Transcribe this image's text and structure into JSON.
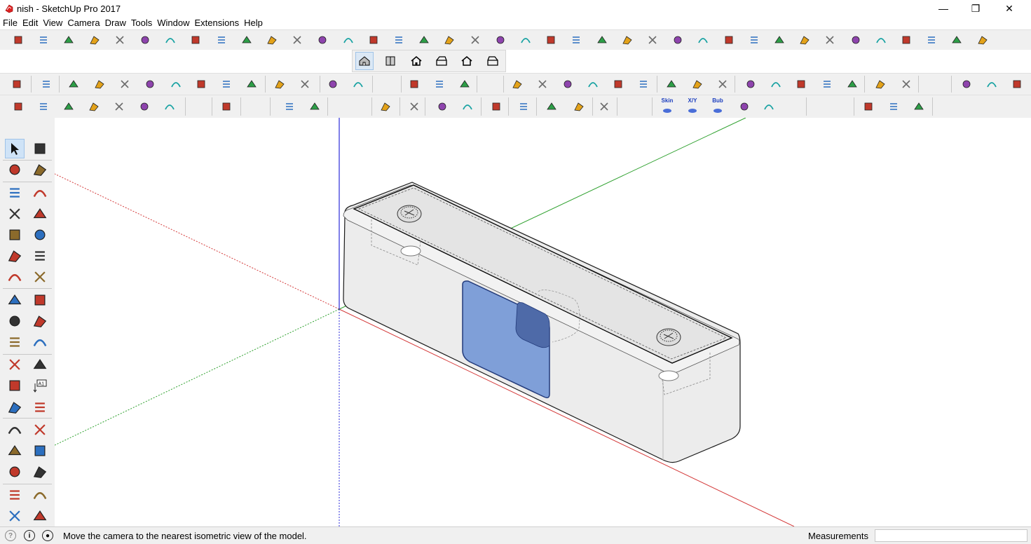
{
  "window": {
    "title": "nish - SketchUp Pro 2017",
    "controls": {
      "minimize": "—",
      "maximize": "❐",
      "close": "✕"
    }
  },
  "menu": [
    "File",
    "Edit",
    "View",
    "Camera",
    "Draw",
    "Tools",
    "Window",
    "Extensions",
    "Help"
  ],
  "toolbar_labels": {
    "skin": "Skin",
    "xy": "X/Y",
    "bub": "Bub"
  },
  "left_toolbar": {
    "tools": [
      "select",
      "component",
      "paint-bucket",
      "eraser",
      "pencil",
      "freehand",
      "rectangle",
      "rotated-rectangle",
      "circle",
      "polygon",
      "arc",
      "pie",
      "two-point-arc",
      "three-point-arc",
      "move",
      "push-pull",
      "rotate",
      "follow-me",
      "scale",
      "offset",
      "tape-measure",
      "dimension",
      "protractor",
      "text",
      "axes",
      "3d-text",
      "orbit",
      "pan",
      "zoom",
      "zoom-window",
      "zoom-extents",
      "previous",
      "position-camera",
      "look-around",
      "walk",
      "section-plane"
    ],
    "text_tool_label": "A1"
  },
  "status": {
    "message": "Move the camera to the nearest isometric view of the model.",
    "measurements_label": "Measurements",
    "measurements_value": ""
  },
  "colors": {
    "axis_red": "#d43a3a",
    "axis_green": "#2da02d",
    "axis_blue": "#2b2bd8",
    "model_face": "#ececec",
    "model_edge": "#1a1a1a",
    "glass": "#7f9fd8",
    "toolbar_bg": "#f0f0f0"
  }
}
